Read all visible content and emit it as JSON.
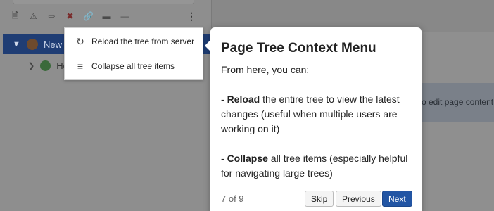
{
  "tree": {
    "toolbar_icons": [
      "new-page-icon",
      "page-warning-icon",
      "page-move-icon",
      "page-delete-icon",
      "link-icon",
      "folder-icon",
      "separator-icon",
      "more-icon"
    ],
    "selected_label": "New T",
    "home_label": "Ho"
  },
  "right": {
    "info_text": "o edit page content"
  },
  "context_menu": {
    "items": [
      {
        "label": "Reload the tree from server",
        "icon": "reload-icon"
      },
      {
        "label": "Collapse all tree items",
        "icon": "collapse-tree-icon"
      }
    ]
  },
  "tour": {
    "title": "Page Tree Context Menu",
    "intro": "From here, you can:",
    "bullet1_prefix": "- ",
    "bullet1_bold": "Reload",
    "bullet1_rest": " the entire tree to view the latest changes (useful when multiple users are working on it)",
    "bullet2_prefix": "- ",
    "bullet2_bold": "Collapse",
    "bullet2_rest": " all tree items (especially helpful for navigating large trees)",
    "step": "7 of 9",
    "skip_label": "Skip",
    "prev_label": "Previous",
    "next_label": "Next"
  },
  "colors": {
    "accent": "#2255a4",
    "selected_row": "#1f3d74"
  }
}
